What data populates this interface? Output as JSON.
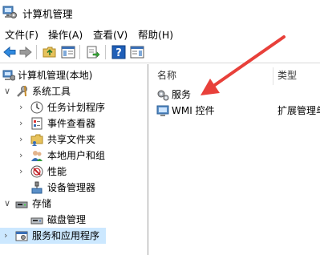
{
  "window": {
    "title": "计算机管理"
  },
  "menu": [
    "文件(F)",
    "操作(A)",
    "查看(V)",
    "帮助(H)"
  ],
  "toolbar": {
    "buttons": [
      "back-icon",
      "forward-icon",
      "up-folder-icon",
      "show-hide-tree-icon",
      "export-list-icon",
      "help-icon",
      "show-action-pane-icon"
    ]
  },
  "tree": {
    "root": "计算机管理(本地)",
    "system_tools": "系统工具",
    "task_scheduler": "任务计划程序",
    "event_viewer": "事件查看器",
    "shared_folders": "共享文件夹",
    "local_users_groups": "本地用户和组",
    "performance": "性能",
    "device_manager": "设备管理器",
    "storage": "存储",
    "disk_management": "磁盘管理",
    "services_apps": "服务和应用程序"
  },
  "list": {
    "columns": [
      "名称",
      "类型"
    ],
    "rows": [
      {
        "name": "服务",
        "type": ""
      },
      {
        "name": "WMI 控件",
        "type": "扩展管理单"
      }
    ]
  },
  "annotation": {
    "color": "#e8403a"
  }
}
